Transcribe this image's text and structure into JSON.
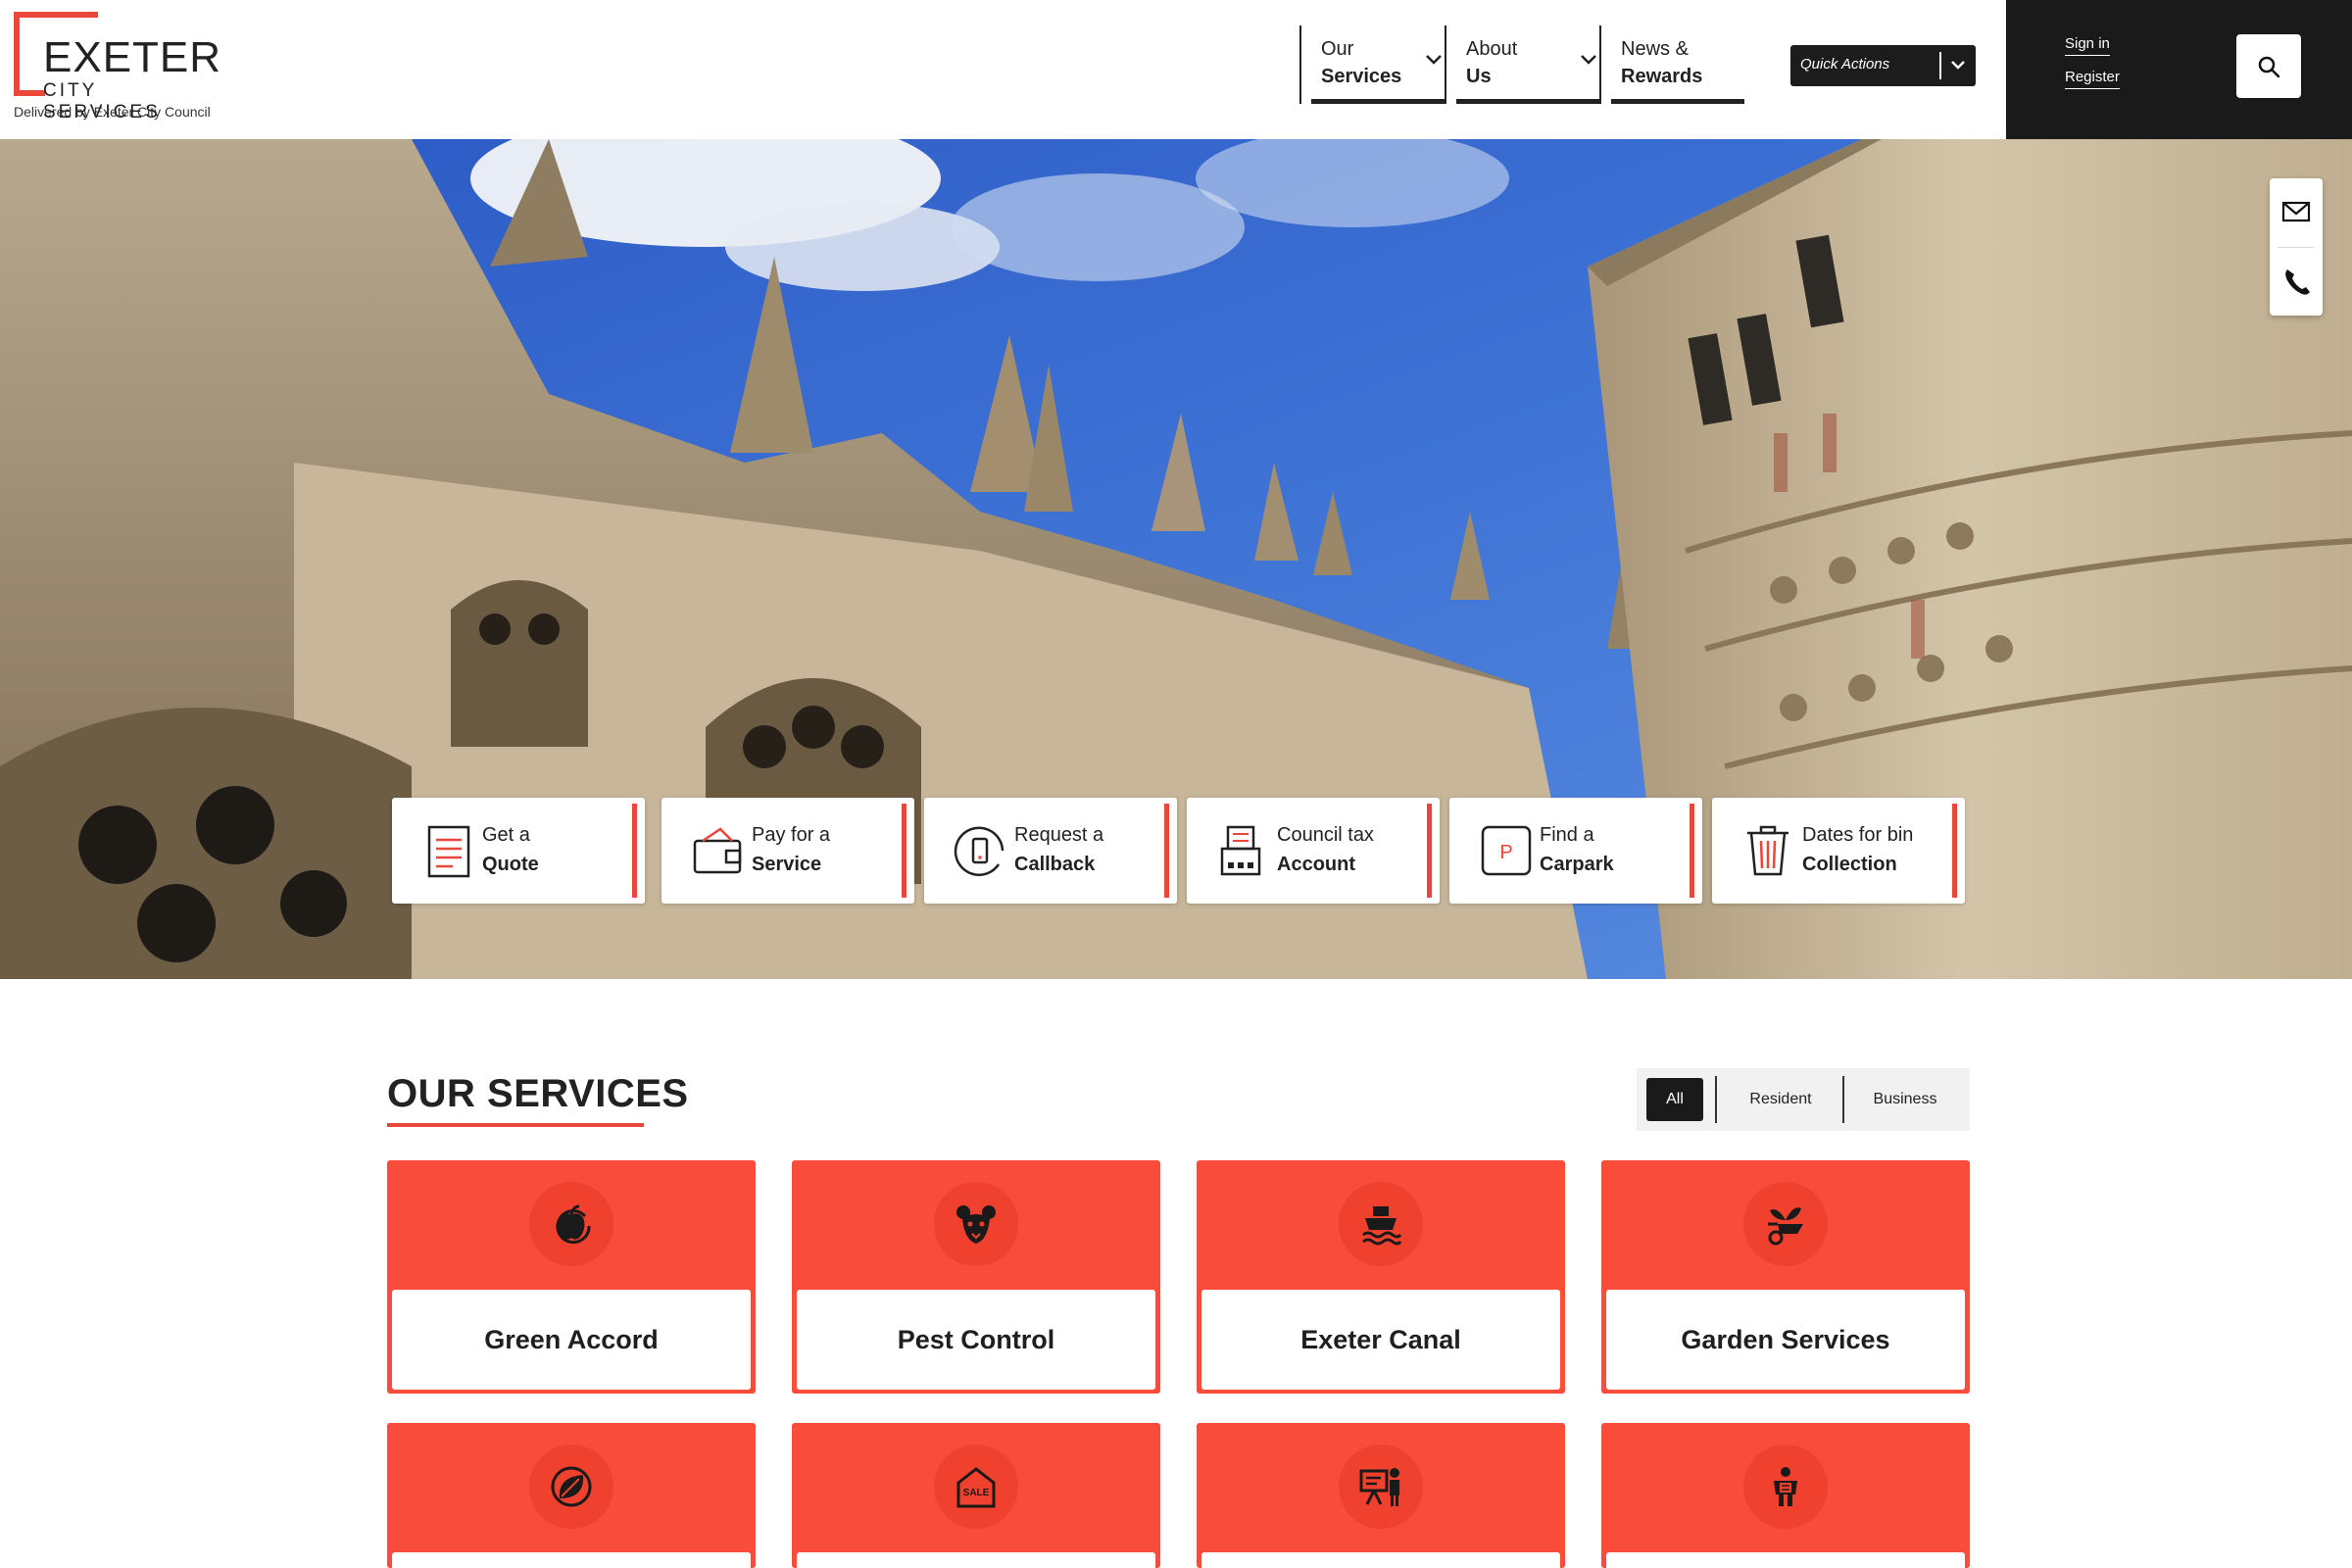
{
  "logo": {
    "main": "EXETER",
    "sub": "CITY SERVICES",
    "tagline": "Delivered by Exeter City Council"
  },
  "nav": [
    {
      "line1": "Our",
      "line2": "Services",
      "has_dropdown": true
    },
    {
      "line1": "About",
      "line2": "Us",
      "has_dropdown": true
    },
    {
      "line1": "News &",
      "line2": "Rewards",
      "has_dropdown": false
    }
  ],
  "quick_actions": {
    "label": "Quick Actions"
  },
  "account": {
    "sign_in": "Sign in",
    "register": "Register"
  },
  "side_contact": {
    "email_icon": "envelope-icon",
    "phone_icon": "phone-icon"
  },
  "quick_links": [
    {
      "line1": "Get a",
      "line2": "Quote",
      "icon": "document-icon"
    },
    {
      "line1": "Pay for a",
      "line2": "Service",
      "icon": "wallet-icon"
    },
    {
      "line1": "Request a",
      "line2": "Callback",
      "icon": "phone-callback-icon"
    },
    {
      "line1": "Council tax",
      "line2": "Account",
      "icon": "council-tax-icon"
    },
    {
      "line1": "Find a",
      "line2": "Carpark",
      "icon": "parking-icon"
    },
    {
      "line1": "Dates for bin",
      "line2": "Collection",
      "icon": "bin-icon"
    }
  ],
  "services": {
    "title_light": "OUR",
    "title_bold": "SERVICES",
    "filters": [
      {
        "label": "All",
        "active": true
      },
      {
        "label": "Resident",
        "active": false
      },
      {
        "label": "Business",
        "active": false
      }
    ],
    "cards": [
      {
        "label": "Green Accord",
        "icon": "apple-recycle-icon"
      },
      {
        "label": "Pest Control",
        "icon": "rodent-icon"
      },
      {
        "label": "Exeter Canal",
        "icon": "boat-icon"
      },
      {
        "label": "Garden Services",
        "icon": "wheelbarrow-plant-icon"
      },
      {
        "label": "",
        "icon": "leaf-icon"
      },
      {
        "label": "",
        "icon": "sale-house-icon"
      },
      {
        "label": "",
        "icon": "presentation-icon"
      },
      {
        "label": "",
        "icon": "person-clipboard-icon"
      }
    ]
  },
  "colors": {
    "accent": "#e8473a",
    "card_red": "#fa4c3a",
    "dark": "#1a1a1a"
  }
}
